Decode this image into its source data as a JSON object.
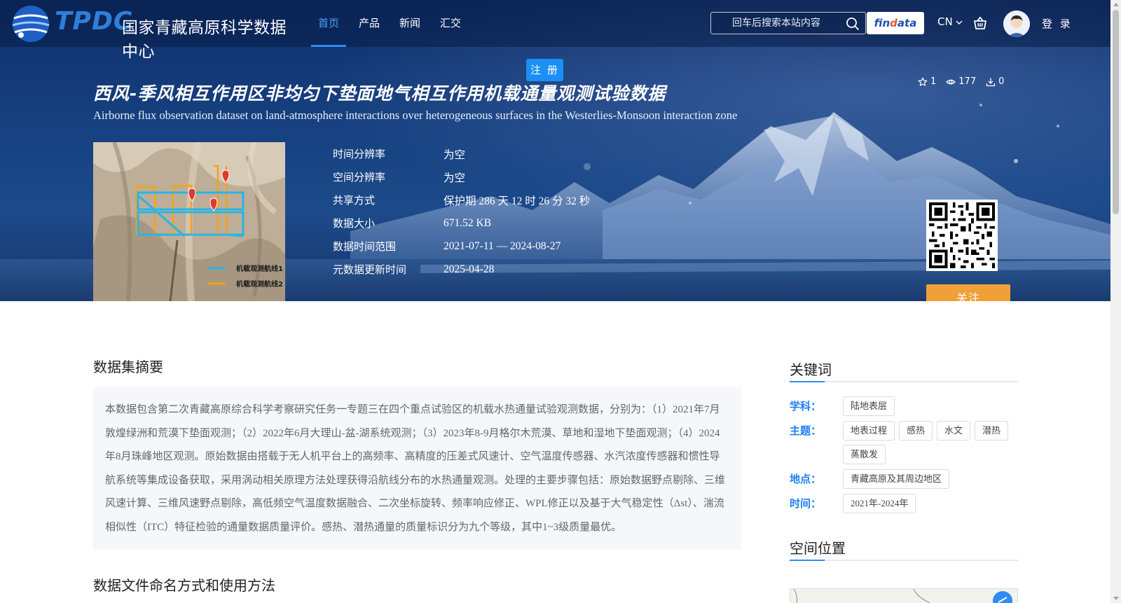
{
  "header": {
    "logo_text": "TPDC",
    "logo_cn": "国家青藏高原科学数据中心",
    "nav": [
      {
        "label": "首页",
        "active": true
      },
      {
        "label": "产品",
        "active": false
      },
      {
        "label": "新闻",
        "active": false
      },
      {
        "label": "汇交",
        "active": false
      }
    ],
    "search_placeholder": "回车后搜索本站内容",
    "findata_label_a": "fin",
    "findata_label_b": "d",
    "findata_label_c": "ata",
    "lang": "CN",
    "login": "登 录",
    "register": "注 册"
  },
  "dataset": {
    "title_cn": "西风-季风相互作用区非均匀下垫面地气相互作用机载通量观测试验数据",
    "title_en": "Airborne flux observation dataset on land-atmosphere interactions over heterogeneous surfaces in the Westerlies-Monsoon interaction zone",
    "stats": {
      "favorites": "1",
      "views": "177",
      "downloads": "0"
    },
    "thumbnail_legend": [
      "机载观测航线1",
      "机载观测航线2"
    ],
    "meta": [
      {
        "label": "时间分辨率",
        "value": "为空"
      },
      {
        "label": "空间分辨率",
        "value": "为空"
      },
      {
        "label": "共享方式",
        "value": "保护期 286 天 12 时 26 分 32 秒"
      },
      {
        "label": "数据大小",
        "value": "671.52 KB"
      },
      {
        "label": "数据时间范围",
        "value": "2021-07-11 — 2024-08-27"
      },
      {
        "label": "元数据更新时间",
        "value": "2025-04-28"
      }
    ],
    "follow": "关注"
  },
  "abstract": {
    "title": "数据集摘要",
    "text": "本数据包含第二次青藏高原综合科学考察研究任务一专题三在四个重点试验区的机载水热通量试验观测数据，分别为：（1）2021年7月敦煌绿洲和荒漠下垫面观测；（2）2022年6月大理山-盆-湖系统观测；（3）2023年8-9月格尔木荒漠、草地和湿地下垫面观测；（4）2024年8月珠峰地区观测。原始数据由搭载于无人机平台上的高频率、高精度的压差式风速计、空气温度传感器、水汽浓度传感器和惯性导航系统等集成设备获取，采用涡动相关原理方法处理获得沿航线分布的水热通量观测。处理的主要步骤包括：原始数据野点剔除、三维风速计算、三维风速野点剔除，高低频空气温度数据融合、二次坐标旋转、频率响应修正、WPL修正以及基于大气稳定性（Δst）、湍流相似性（ITC）特征检验的通量数据质量评价。感热、潜热通量的质量标识分为九个等级，其中1~3级质量最优。"
  },
  "file_naming": {
    "title": "数据文件命名方式和使用方法"
  },
  "sidebar": {
    "keywords_title": "关键词",
    "keywords": [
      {
        "label": "学科：",
        "tags": [
          "陆地表层"
        ]
      },
      {
        "label": "主题：",
        "tags": [
          "地表过程",
          "感热",
          "水文",
          "潜热",
          "蒸散发"
        ]
      },
      {
        "label": "地点：",
        "tags": [
          "青藏高原及其周边地区"
        ]
      },
      {
        "label": "时间：",
        "tags": [
          "2021年-2024年"
        ]
      }
    ],
    "location_title": "空间位置"
  },
  "colors": {
    "accent": "#2f8cf0",
    "follow": "#f0a037",
    "register": "#1a8ff5",
    "keyword_label": "#1d7ff0"
  }
}
